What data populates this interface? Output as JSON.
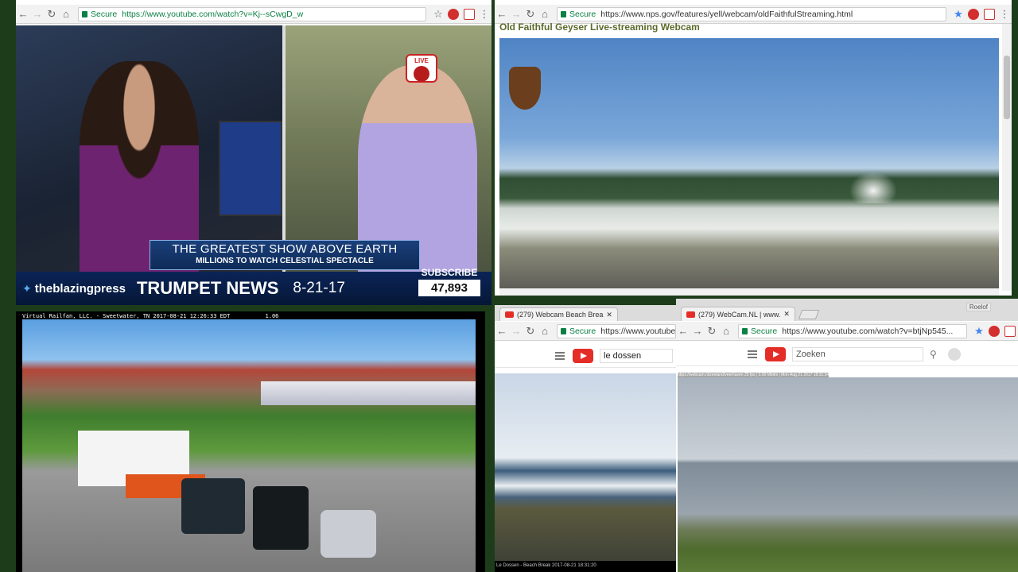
{
  "win_news": {
    "url": "https://www.youtube.com/watch?v=Kj--sCwgD_w",
    "secure": "Secure",
    "headline": "THE GREATEST SHOW ABOVE EARTH",
    "subheadline": "MILLIONS TO WATCH CELESTIAL SPECTACLE",
    "handle": "theblazingpress",
    "brand": "TRUMPET NEWS",
    "date": "8-21-17",
    "subscribe_label": "SUBSCRIBE",
    "subscriber_count": "47,893",
    "live_badge": "LIVE"
  },
  "win_nps": {
    "url": "https://www.nps.gov/features/yell/webcam/oldFaithfulStreaming.html",
    "secure": "Secure",
    "page_title": "Old Faithful Geyser Live-streaming Webcam"
  },
  "win_railfan": {
    "caption": "Virtual Railfan, LLC. - Sweetwater, TN   2017-08-21 12:26:33 EDT",
    "caption_right": "1.06"
  },
  "win_beach": {
    "tab_title": "(279) Webcam Beach Brea",
    "url": "https://www.youtube",
    "secure": "Secure",
    "search_value": "le dossen",
    "footer_caption": "Le Dossen - Beach Break   2017-08-21 18:31:20"
  },
  "win_webcamnl": {
    "tab_title": "(279) WebCam.NL | www.",
    "profile_label": "Roelof",
    "url": "https://www.youtube.com/watch?v=btjNp545...",
    "secure": "Secure",
    "search_placeholder": "Zoeken",
    "overlay_caption": "https://webcam.nl/zeeland/veerhaven  25 fps | 0.00 Mbit/s | Mon Aug 21 2017 18:31:34"
  }
}
